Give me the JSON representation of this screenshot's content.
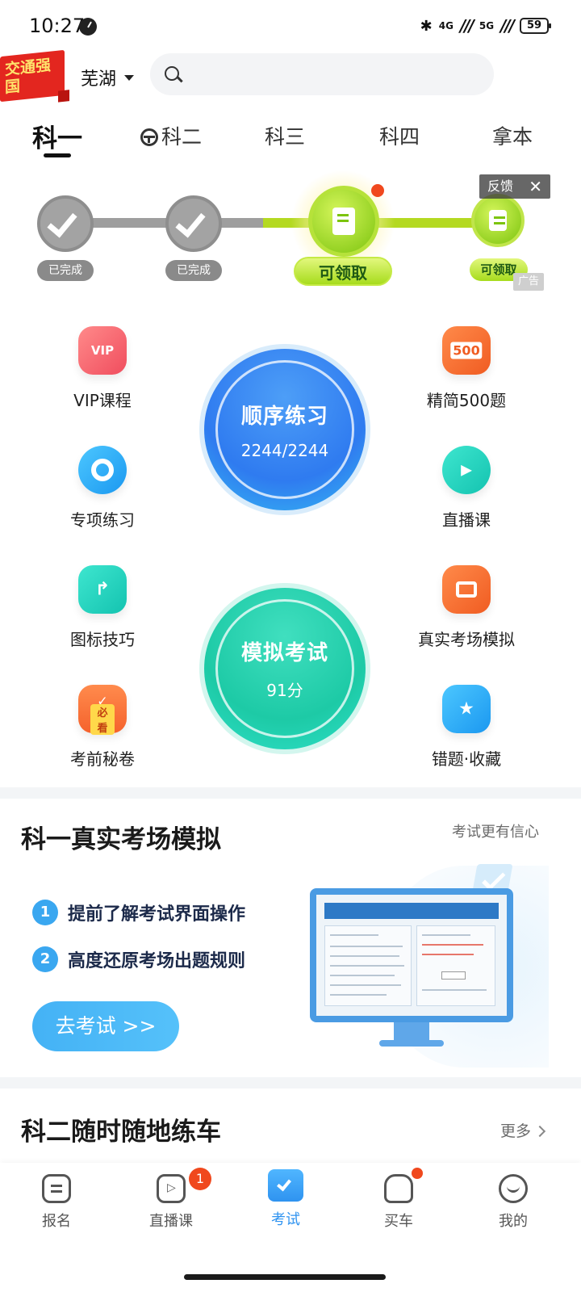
{
  "status_bar": {
    "time": "10:27",
    "network_left": "4G",
    "network_right": "5G",
    "battery": "59"
  },
  "header": {
    "badge_text": "交通强国",
    "city": "芜湖",
    "search_placeholder": ""
  },
  "tabs": [
    {
      "label": "科一",
      "active": true
    },
    {
      "label": "科二",
      "active": false
    },
    {
      "label": "科三",
      "active": false
    },
    {
      "label": "科四",
      "active": false
    },
    {
      "label": "拿本",
      "active": false
    }
  ],
  "progress": {
    "steps": [
      {
        "label": "已完成",
        "state": "done"
      },
      {
        "label": "已完成",
        "state": "done"
      },
      {
        "label": "可领取",
        "state": "current"
      },
      {
        "label": "可领取",
        "state": "next"
      }
    ],
    "feedback": "反馈",
    "ad_label": "广告"
  },
  "features": {
    "vip": "VIP课程",
    "jingjian": "精简500题",
    "zhuanxiang": "专项练习",
    "zhibo": "直播课",
    "tubiao": "图标技巧",
    "zhenshi": "真实考场模拟",
    "kaoqian": "考前秘卷",
    "cuoti": "错题·收藏",
    "icon_500": "500",
    "icon_bikan": "必看",
    "icon_vip": "VIP"
  },
  "practice": {
    "title": "顺序练习",
    "value": "2244/2244",
    "progress": 1.0
  },
  "mock_exam": {
    "title": "模拟考试",
    "value": "91分",
    "progress": 0.91
  },
  "real_exam_section": {
    "title": "科一真实考场模拟",
    "subtitle": "考试更有信心",
    "points": [
      {
        "num": "1",
        "text": "提前了解考试界面操作"
      },
      {
        "num": "2",
        "text": "高度还原考场出题规则"
      }
    ],
    "button": "去考试 >>"
  },
  "practice_car_section": {
    "title": "科二随时随地练车",
    "more": "更多"
  },
  "bottom_nav": [
    {
      "label": "报名",
      "active": false
    },
    {
      "label": "直播课",
      "active": false,
      "badge": "1"
    },
    {
      "label": "考试",
      "active": true
    },
    {
      "label": "买车",
      "active": false
    },
    {
      "label": "我的",
      "active": false
    }
  ],
  "colors": {
    "accent_blue": "#2f93f0",
    "practice_blue": "#3d8ef2",
    "mock_green": "#20d1b0",
    "alert_red": "#f0481d",
    "progress_green": "#a7dc1d"
  }
}
